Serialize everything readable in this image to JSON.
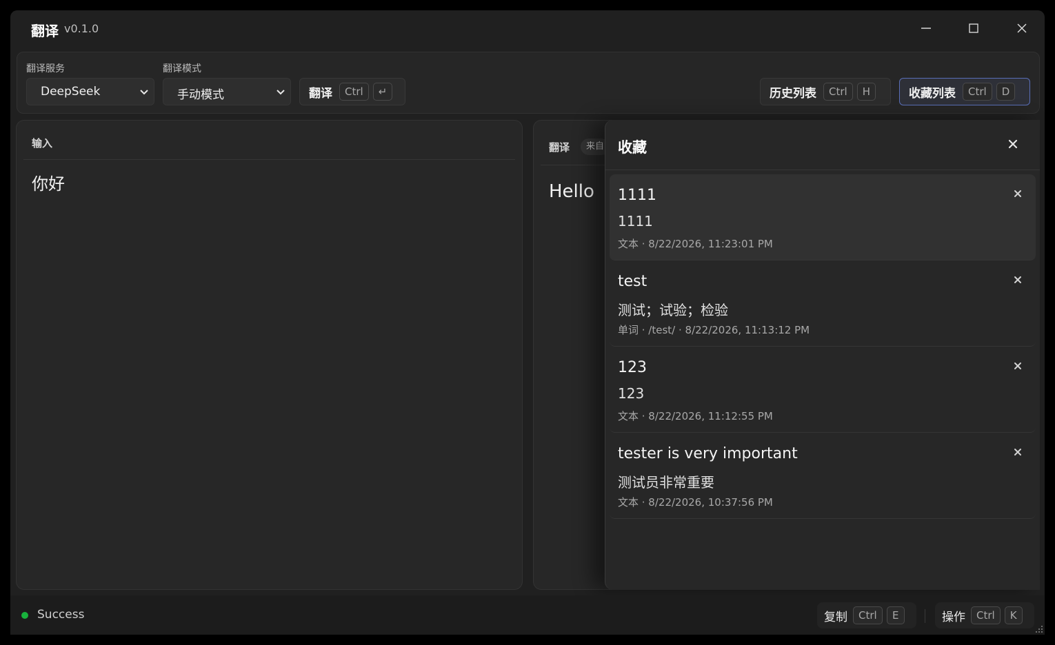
{
  "titlebar": {
    "title": "翻译",
    "version": "v0.1.0"
  },
  "toolbar": {
    "service_label": "翻译服务",
    "service_value": "DeepSeek",
    "mode_label": "翻译模式",
    "mode_value": "手动模式",
    "translate_button": {
      "label": "翻译",
      "keys": [
        "Ctrl",
        "↵"
      ]
    },
    "history_button": {
      "label": "历史列表",
      "keys": [
        "Ctrl",
        "H"
      ]
    },
    "favorites_button": {
      "label": "收藏列表",
      "keys": [
        "Ctrl",
        "D"
      ]
    }
  },
  "input_panel": {
    "label": "输入",
    "text": "你好"
  },
  "output_panel": {
    "label": "翻译",
    "source_badge": "来自",
    "text": "Hello"
  },
  "favorites": {
    "title": "收藏",
    "items": [
      {
        "source": "1111",
        "translation": "1111",
        "meta": "文本 · 8/22/2026, 11:23:01 PM"
      },
      {
        "source": "test",
        "translation": "测试；试验；检验",
        "meta": "单词 · /test/ · 8/22/2026, 11:13:12 PM"
      },
      {
        "source": "123",
        "translation": "123",
        "meta": "文本 · 8/22/2026, 11:12:55 PM"
      },
      {
        "source": "tester is very important",
        "translation": "测试员非常重要",
        "meta": "文本 · 8/22/2026, 10:37:56 PM"
      }
    ]
  },
  "statusbar": {
    "status": "Success",
    "status_color": "#18b13c",
    "copy_button": {
      "label": "复制",
      "keys": [
        "Ctrl",
        "E"
      ]
    },
    "actions_button": {
      "label": "操作",
      "keys": [
        "Ctrl",
        "K"
      ]
    }
  },
  "colors": {
    "background": "#202020",
    "panel": "#272727",
    "accent_border": "#5a6fb8"
  }
}
